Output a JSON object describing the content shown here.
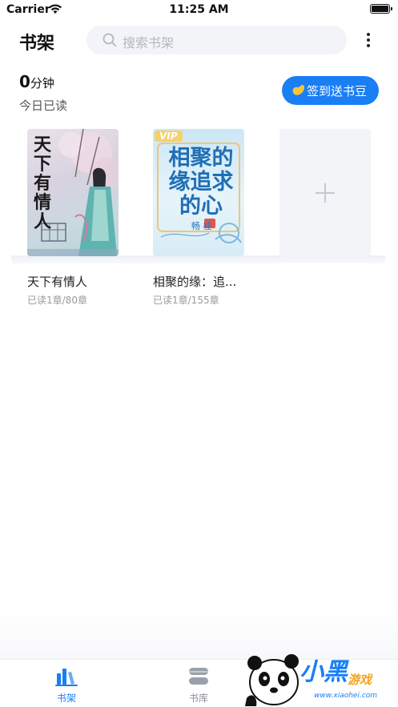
{
  "status_bar": {
    "carrier": "Carrier",
    "time": "11:25 AM",
    "battery_level": 1.0
  },
  "header": {
    "title": "书架",
    "search_placeholder": "搜索书架"
  },
  "reading_stats": {
    "minutes": "0",
    "unit": "分钟",
    "label": "今日已读"
  },
  "checkin": {
    "label": "签到送书豆",
    "icon": "bean-icon"
  },
  "books": [
    {
      "title": "天下有情人",
      "progress": "已读1章/80章",
      "cover_text": "天下有情人",
      "cover_colors": [
        "#e9e2ea",
        "#b9d2d8"
      ]
    },
    {
      "title": "相聚的缘：追...",
      "progress": "已读1章/155章",
      "cover_text": "相聚的缘追求的心",
      "cover_badge": "VIP",
      "cover_author": "畅 桂",
      "cover_colors": [
        "#cbe7f5",
        "#1f6fb5"
      ]
    }
  ],
  "add_book": {
    "icon": "plus-icon"
  },
  "tabs": [
    {
      "label": "书架",
      "icon": "bookshelf-icon",
      "active": true
    },
    {
      "label": "书库",
      "icon": "library-icon",
      "active": false
    }
  ],
  "watermark": {
    "text": "小黑游戏",
    "brand": "小黑",
    "suffix": "游戏",
    "url": "www.xiaohei.com"
  },
  "colors": {
    "accent": "#1a7ef5",
    "muted": "#999999",
    "search_bg": "#f2f4f7"
  }
}
